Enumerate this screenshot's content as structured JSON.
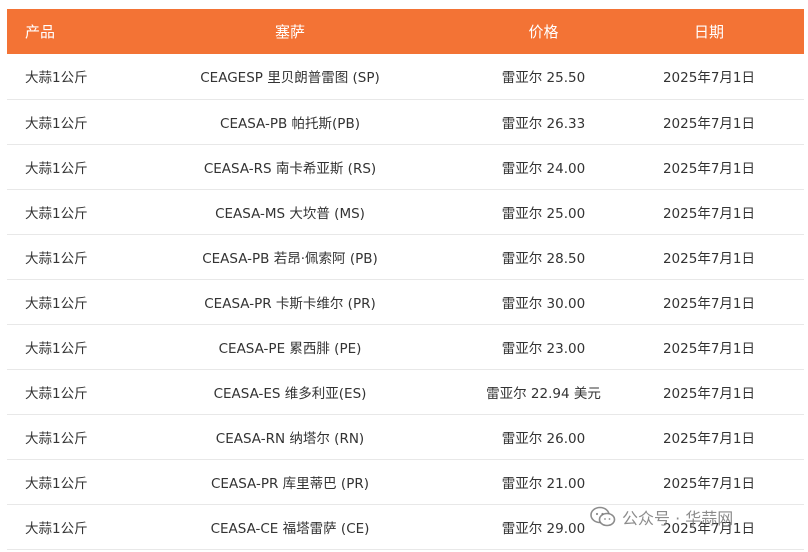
{
  "table": {
    "headers": [
      "产品",
      "塞萨",
      "价格",
      "日期"
    ],
    "rows": [
      [
        "大蒜1公斤",
        "CEAGESP 里贝朗普雷图 (SP)",
        "雷亚尔 25.50",
        "2025年7月1日"
      ],
      [
        "大蒜1公斤",
        "CEASA-PB 帕托斯(PB)",
        "雷亚尔 26.33",
        "2025年7月1日"
      ],
      [
        "大蒜1公斤",
        "CEASA-RS 南卡希亚斯 (RS)",
        "雷亚尔 24.00",
        "2025年7月1日"
      ],
      [
        "大蒜1公斤",
        "CEASA-MS 大坎普 (MS)",
        "雷亚尔 25.00",
        "2025年7月1日"
      ],
      [
        "大蒜1公斤",
        "CEASA-PB 若昂·佩索阿 (PB)",
        "雷亚尔 28.50",
        "2025年7月1日"
      ],
      [
        "大蒜1公斤",
        "CEASA-PR 卡斯卡维尔 (PR)",
        "雷亚尔 30.00",
        "2025年7月1日"
      ],
      [
        "大蒜1公斤",
        "CEASA-PE 累西腓 (PE)",
        "雷亚尔 23.00",
        "2025年7月1日"
      ],
      [
        "大蒜1公斤",
        "CEASA-ES 维多利亚(ES)",
        "雷亚尔 22.94 美元",
        "2025年7月1日"
      ],
      [
        "大蒜1公斤",
        "CEASA-RN 纳塔尔 (RN)",
        "雷亚尔 26.00",
        "2025年7月1日"
      ],
      [
        "大蒜1公斤",
        "CEASA-PR 库里蒂巴 (PR)",
        "雷亚尔 21.00",
        "2025年7月1日"
      ],
      [
        "大蒜1公斤",
        "CEASA-CE 福塔雷萨 (CE)",
        "雷亚尔 29.00",
        "2025年7月1日"
      ]
    ]
  },
  "watermark": {
    "text": "公众号 · 华蒜网",
    "icon": "wechat-icon"
  },
  "colors": {
    "header_bg": "#f37335",
    "header_text": "#ffffff",
    "row_border": "#e8e8e8"
  }
}
